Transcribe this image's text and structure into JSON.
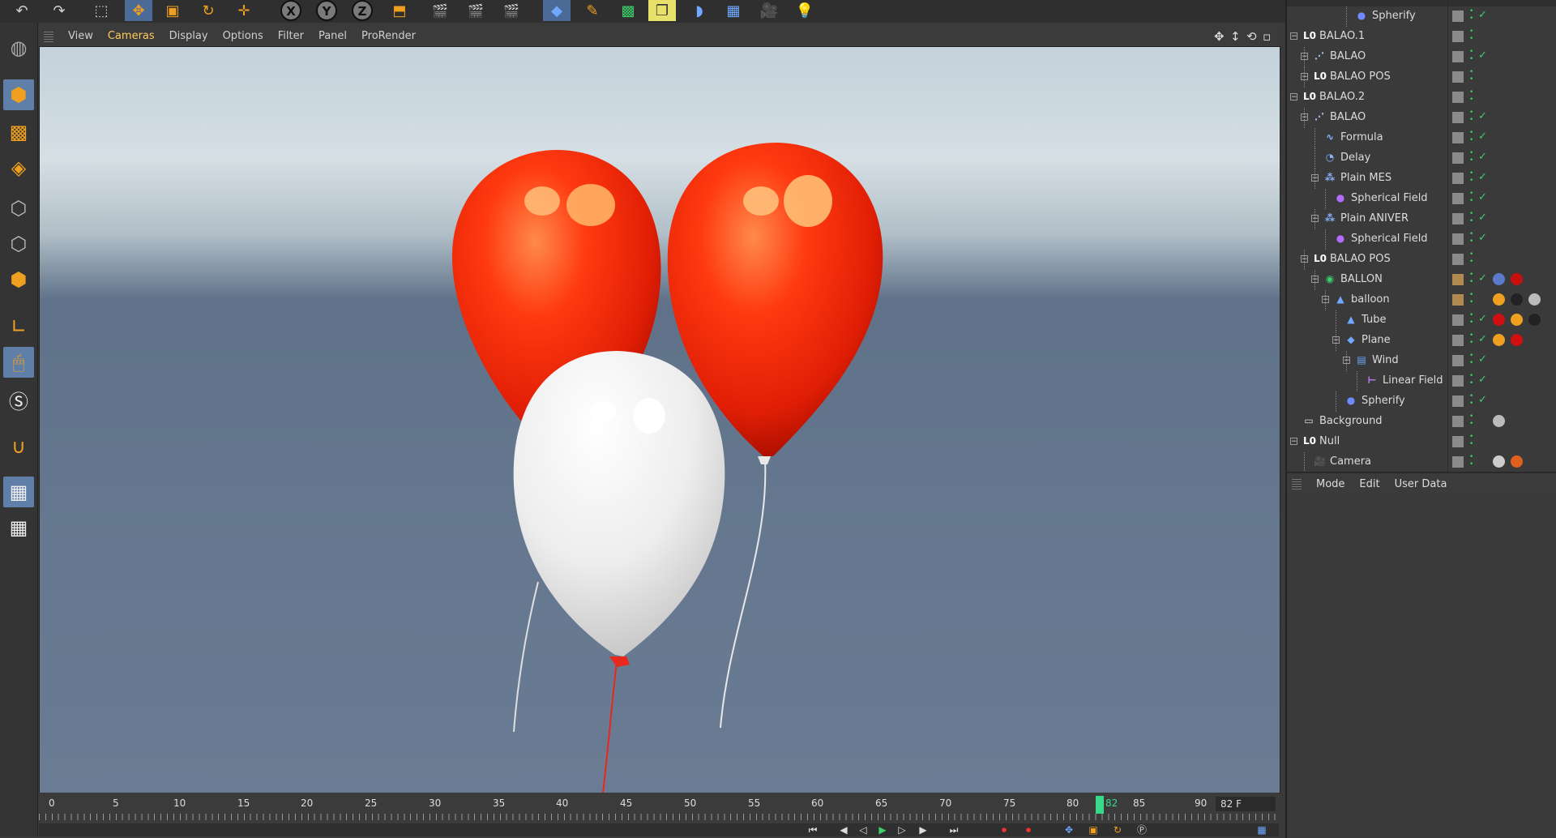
{
  "viewport_menu": [
    "View",
    "Cameras",
    "Display",
    "Options",
    "Filter",
    "Panel",
    "ProRender"
  ],
  "viewport_menu_highlight": "Cameras",
  "timeline": {
    "ticks": [
      "0",
      "5",
      "10",
      "15",
      "20",
      "25",
      "30",
      "35",
      "40",
      "45",
      "50",
      "55",
      "60",
      "65",
      "70",
      "75",
      "80",
      "82",
      "85",
      "90"
    ],
    "current_frame": 82,
    "frame_field": "82 F"
  },
  "object_manager": {
    "items": [
      {
        "name": "Spherify",
        "icon": "spherify-icon",
        "depth": 5,
        "check": true
      },
      {
        "name": "BALAO.1",
        "icon": "null-icon",
        "depth": 0,
        "check": false
      },
      {
        "name": "BALAO",
        "icon": "cloner-icon",
        "depth": 1,
        "check": true
      },
      {
        "name": "BALAO POS",
        "icon": "null-icon",
        "depth": 1,
        "check": false
      },
      {
        "name": "BALAO.2",
        "icon": "null-icon",
        "depth": 0,
        "check": false
      },
      {
        "name": "BALAO",
        "icon": "cloner-icon",
        "depth": 1,
        "check": true
      },
      {
        "name": "Formula",
        "icon": "formula-icon",
        "depth": 2,
        "check": true
      },
      {
        "name": "Delay",
        "icon": "delay-icon",
        "depth": 2,
        "check": true
      },
      {
        "name": "Plain MES",
        "icon": "plain-effector-icon",
        "depth": 2,
        "check": true
      },
      {
        "name": "Spherical Field",
        "icon": "spherical-field-icon",
        "depth": 3,
        "check": true
      },
      {
        "name": "Plain ANIVER",
        "icon": "plain-effector-icon",
        "depth": 2,
        "check": true
      },
      {
        "name": "Spherical Field",
        "icon": "spherical-field-icon",
        "depth": 3,
        "check": true
      },
      {
        "name": "BALAO POS",
        "icon": "null-icon",
        "depth": 1,
        "check": false
      },
      {
        "name": "BALLON",
        "icon": "connect-icon",
        "depth": 2,
        "check": true
      },
      {
        "name": "balloon",
        "icon": "polygon-icon",
        "depth": 3,
        "check": false
      },
      {
        "name": "Tube",
        "icon": "polygon-icon",
        "depth": 4,
        "check": true
      },
      {
        "name": "Plane",
        "icon": "plane-icon",
        "depth": 4,
        "check": true
      },
      {
        "name": "Wind",
        "icon": "wind-icon",
        "depth": 5,
        "check": true
      },
      {
        "name": "Linear Field",
        "icon": "linear-field-icon",
        "depth": 6,
        "check": true
      },
      {
        "name": "Spherify",
        "icon": "spherify-icon",
        "depth": 4,
        "check": true
      },
      {
        "name": "Background",
        "icon": "background-icon",
        "depth": 0,
        "check": false
      },
      {
        "name": "Null",
        "icon": "null-icon",
        "depth": 0,
        "check": false
      },
      {
        "name": "Camera",
        "icon": "camera-icon",
        "depth": 1,
        "check": false
      }
    ]
  },
  "attributes_menu": [
    "Mode",
    "Edit",
    "User Data"
  ],
  "colors": {
    "balloon_red": "#e8280c",
    "balloon_white": "#f1f1f1",
    "accent_green": "#3bd06a",
    "highlight_yellow": "#ffcb5c"
  }
}
